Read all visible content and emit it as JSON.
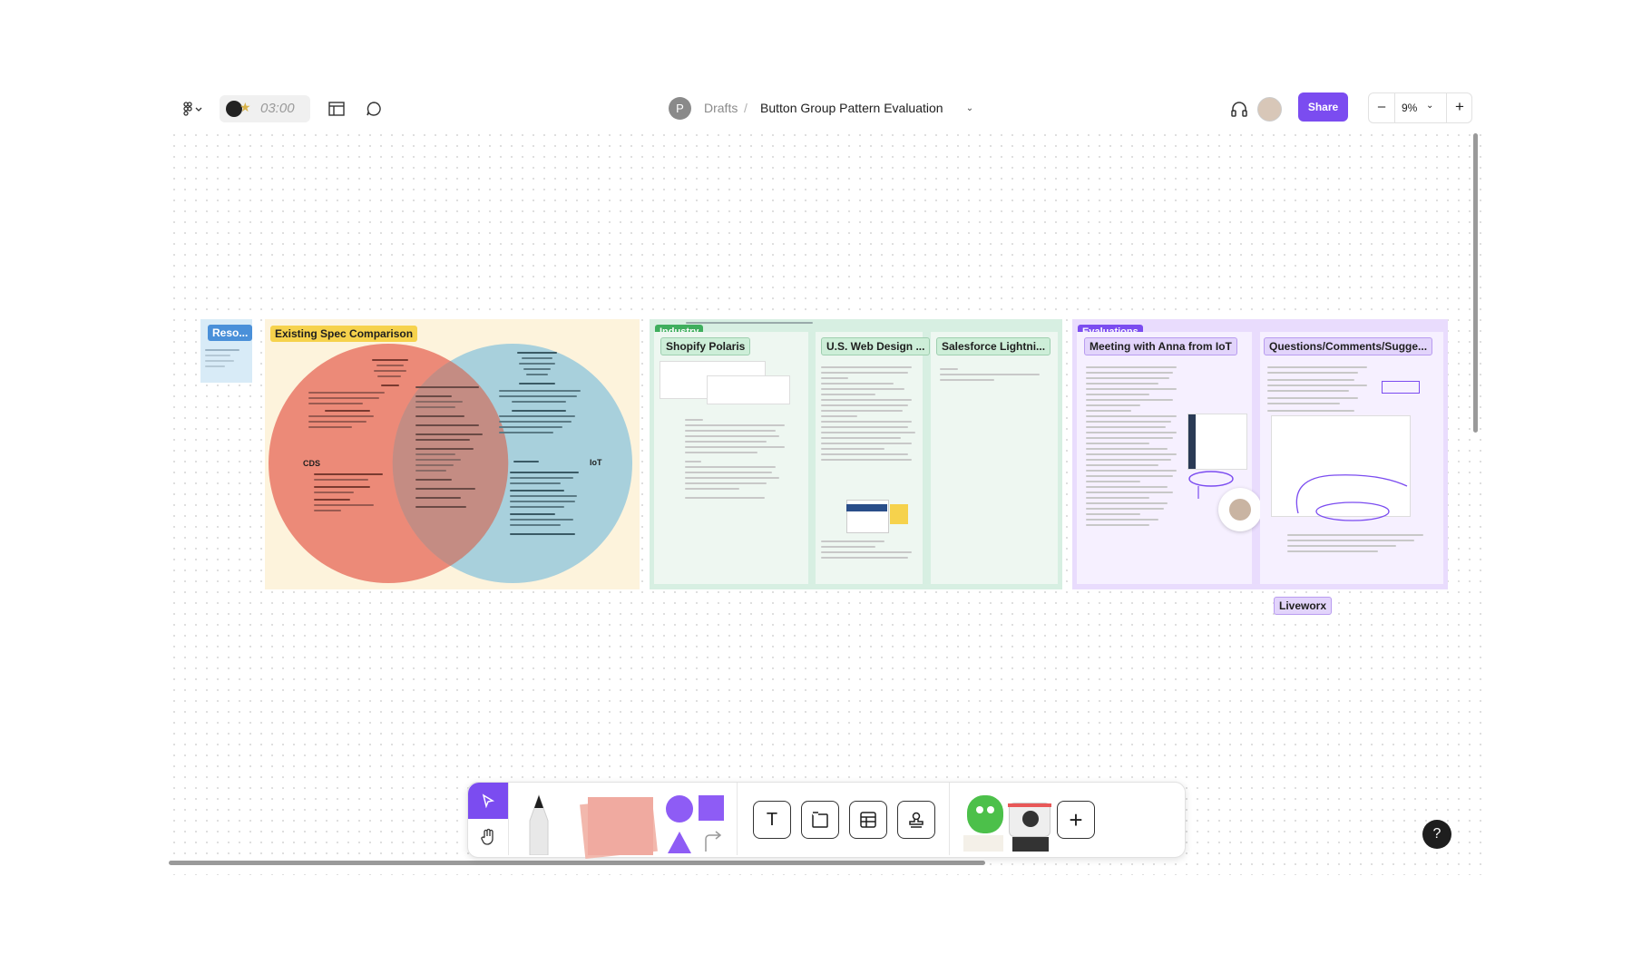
{
  "topbar": {
    "timer": "03:00",
    "avatar_initial": "P",
    "breadcrumb_parent": "Drafts",
    "breadcrumb_sep": "/",
    "file_name": "Button Group Pattern Evaluation",
    "share_label": "Share",
    "zoom_minus": "–",
    "zoom_level": "9%",
    "zoom_plus": "+"
  },
  "board": {
    "resources_label": "Reso...",
    "existing_spec_title": "Existing Spec Comparison",
    "venn_left": "CDS",
    "venn_right": "IoT",
    "industry_tag": "Industry",
    "industry_cards": [
      "Shopify Polaris",
      "U.S. Web Design ...",
      "Salesforce Lightni..."
    ],
    "evaluations_tag": "Evaluations",
    "eval_cards": [
      "Meeting with Anna from IoT",
      "Questions/Comments/Sugge..."
    ],
    "liveworx_label": "Liveworx"
  },
  "colors": {
    "accent": "#7b4cf0",
    "venn_left": "#ec8a78",
    "venn_right": "#a8d0dc",
    "existing_bg": "#fdf3dc",
    "industry_bg": "#d7efe2",
    "evaluations_bg": "#e9dcfd"
  },
  "toolbar": {
    "select_icon": "cursor-icon",
    "hand_icon": "hand-icon",
    "text_tool": "T",
    "add_label": "+"
  },
  "help_label": "?"
}
